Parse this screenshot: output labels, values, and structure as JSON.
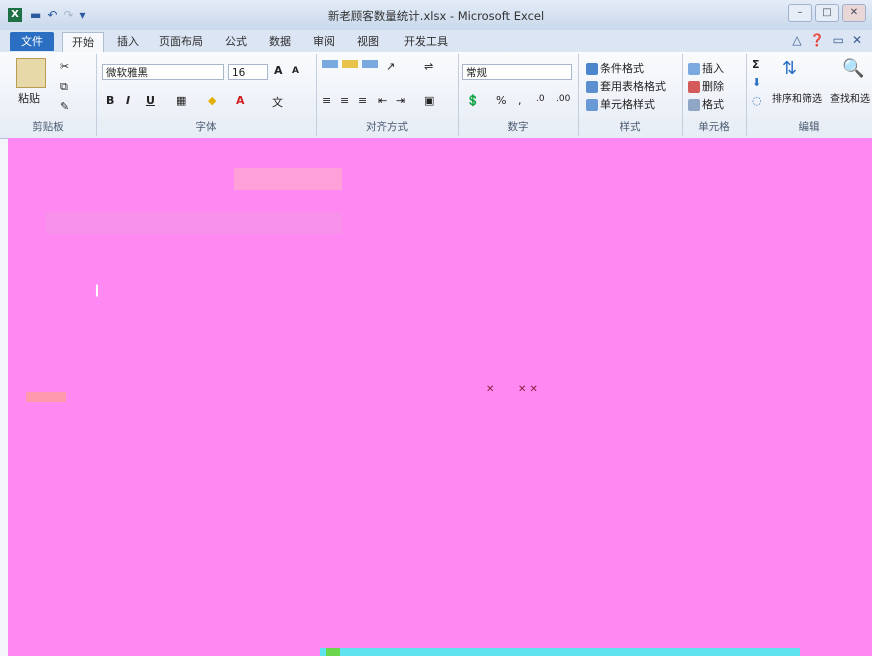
{
  "window": {
    "title": "新老顾客数量统计.xlsx - Microsoft Excel",
    "app_icon": "X"
  },
  "quick_access": [
    "save-icon",
    "undo-icon",
    "redo-icon",
    "customize-icon"
  ],
  "tabs": [
    {
      "label": "文件",
      "kind": "file"
    },
    {
      "label": "开始",
      "kind": "active"
    },
    {
      "label": "插入",
      "kind": "normal"
    },
    {
      "label": "页面布局",
      "kind": "normal"
    },
    {
      "label": "公式",
      "kind": "normal"
    },
    {
      "label": "数据",
      "kind": "normal"
    },
    {
      "label": "审阅",
      "kind": "normal"
    },
    {
      "label": "视图",
      "kind": "normal"
    },
    {
      "label": "开发工具",
      "kind": "normal"
    }
  ],
  "ribbon": {
    "clipboard": {
      "group_label": "剪贴板",
      "paste_label": "粘贴"
    },
    "font": {
      "group_label": "字体",
      "font_name": "微软雅黑",
      "font_size": "16",
      "bold": "B",
      "italic": "I",
      "underline": "U"
    },
    "alignment": {
      "group_label": "对齐方式"
    },
    "number": {
      "group_label": "数字",
      "format": "常规",
      "percent": "%"
    },
    "styles": {
      "group_label": "样式",
      "conditional": "条件格式",
      "table": "套用表格格式",
      "cell_styles": "单元格样式"
    },
    "cells": {
      "group_label": "单元格",
      "insert": "插入",
      "delete": "删除",
      "format": "格式"
    },
    "editing": {
      "group_label": "编辑",
      "sigma": "Σ",
      "sort": "排序和筛选",
      "find": "查找和选"
    }
  },
  "colors": {
    "accent": "#2b6fc2",
    "canvas": "#ff88f2",
    "brand_excel": "#1e7145"
  }
}
